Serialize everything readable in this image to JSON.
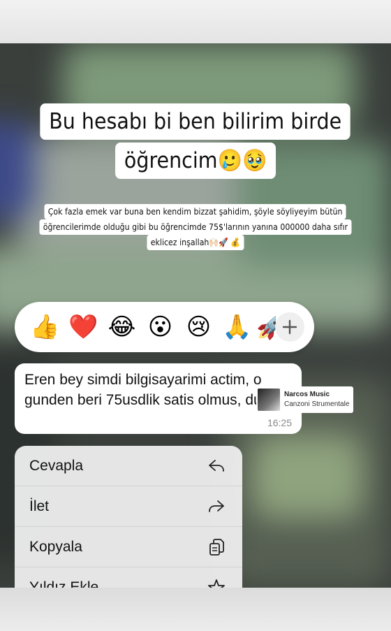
{
  "overlay": {
    "title_line1": "Bu hesabı bi ben bilirim birde",
    "title_line2": "öğrencim🥲🥹",
    "caption_line1": "Çok fazla emek var buna ben kendim bizzat şahidim, şöyle söyliyeyim bütün",
    "caption_line2": "öğrencilerimde olduğu gibi bu öğrencimde 75$'larının yanına 000000 daha sıfır",
    "caption_line3": "eklicez inşallah🙌🏻🚀 💰"
  },
  "reactions": {
    "items": [
      "👍",
      "❤️",
      "😂",
      "😮",
      "😢",
      "🙏",
      "🚀"
    ],
    "more_icon": "plus-icon"
  },
  "message": {
    "text": "Eren bey simdi bilgisayarimi actim, o gunden beri 75usdlik satis olmus, dun☺️",
    "time": "16:25"
  },
  "music": {
    "title": "Narcos Music",
    "subtitle": "Canzoni Strumentale"
  },
  "menu": {
    "items": [
      {
        "label": "Cevapla",
        "icon": "reply-icon"
      },
      {
        "label": "İlet",
        "icon": "forward-icon"
      },
      {
        "label": "Kopyala",
        "icon": "copy-icon"
      },
      {
        "label": "Yıldız Ekle",
        "icon": "star-icon"
      }
    ]
  }
}
